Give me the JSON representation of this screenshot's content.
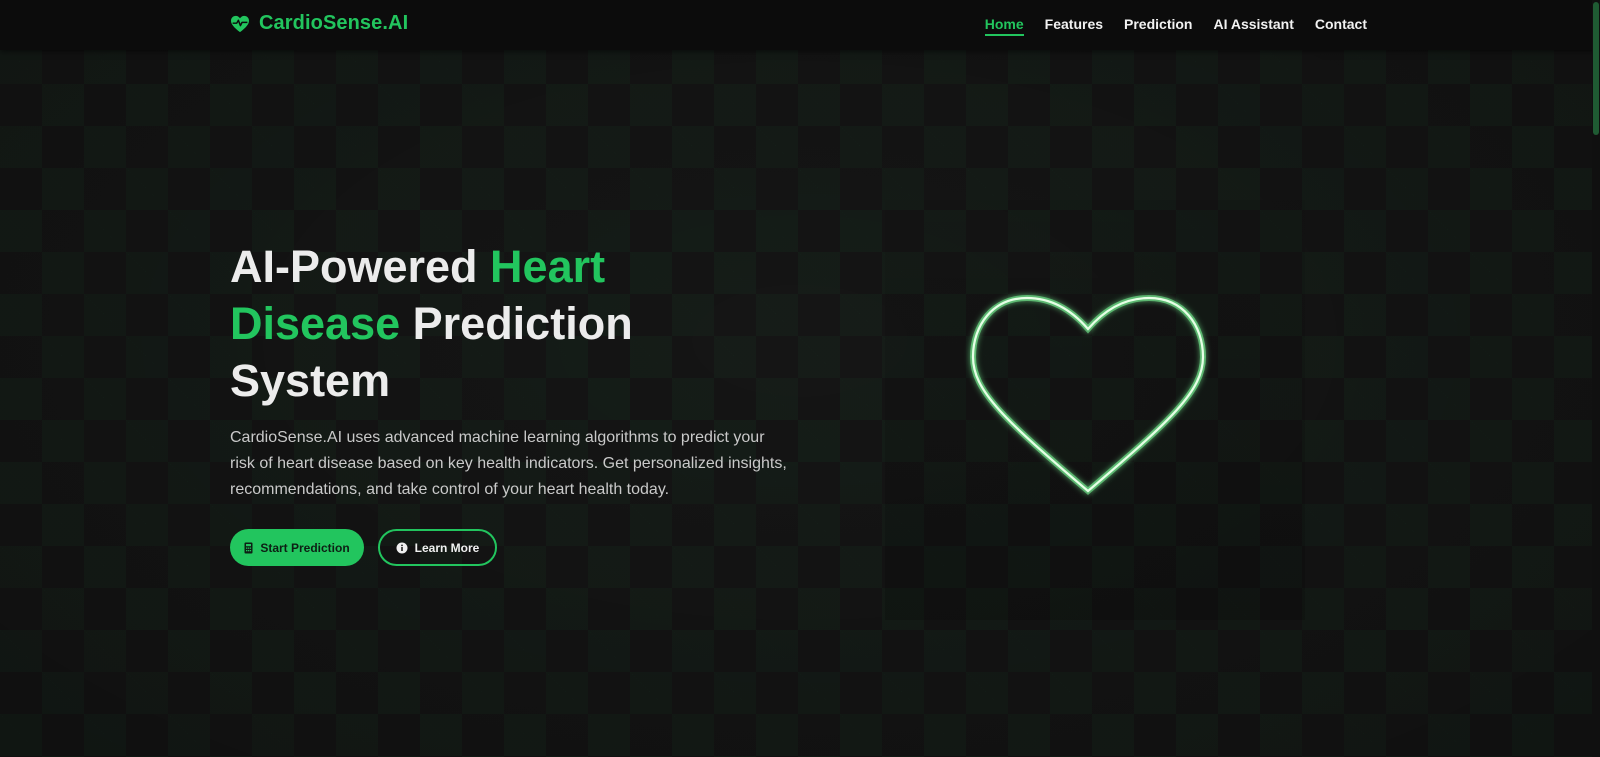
{
  "brand": {
    "name": "CardioSense.AI",
    "icon": "heart-pulse-icon",
    "color": "#22c55e"
  },
  "nav": {
    "items": [
      {
        "label": "Home",
        "active": true
      },
      {
        "label": "Features",
        "active": false
      },
      {
        "label": "Prediction",
        "active": false
      },
      {
        "label": "AI Assistant",
        "active": false
      },
      {
        "label": "Contact",
        "active": false
      }
    ]
  },
  "hero": {
    "title_part1": "AI-Powered ",
    "title_highlight": "Heart Disease",
    "title_part2": " Prediction System",
    "description": "CardioSense.AI uses advanced machine learning algorithms to predict your risk of heart disease based on key health indicators. Get personalized insights, recommendations, and take control of your heart health today.",
    "primary_button": {
      "label": "Start Prediction",
      "icon": "calculator-icon"
    },
    "secondary_button": {
      "label": "Learn More",
      "icon": "info-circle-icon"
    },
    "graphic_icon": "heart-outline-icon"
  },
  "colors": {
    "accent": "#22c55e",
    "background": "#151515",
    "navbar": "#0c0c0c",
    "heart_glow": "#d9ffd9"
  }
}
